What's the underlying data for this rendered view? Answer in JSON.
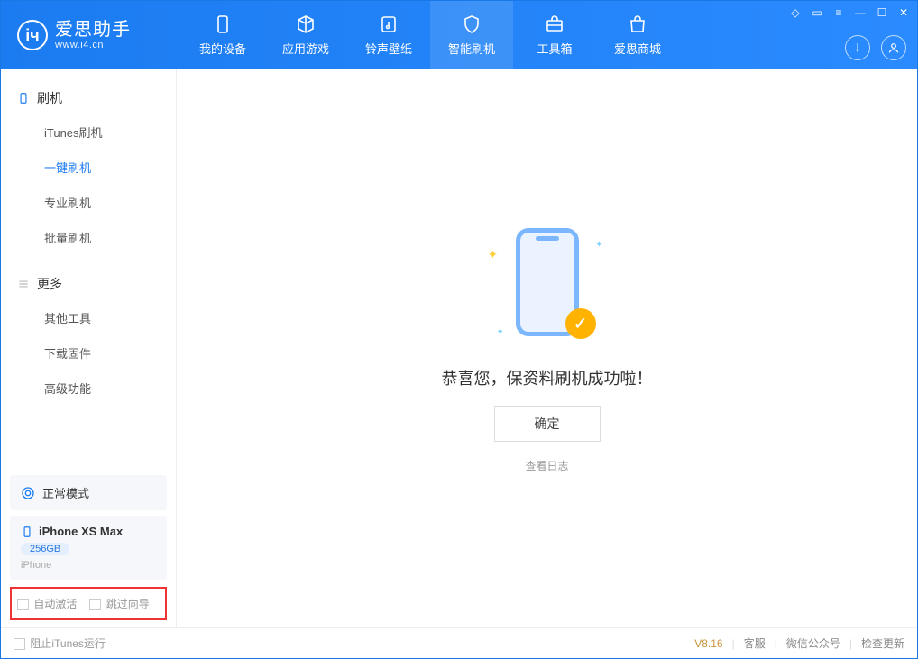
{
  "app": {
    "name": "爱思助手",
    "domain": "www.i4.cn"
  },
  "tabs": {
    "device": "我的设备",
    "apps": "应用游戏",
    "ring": "铃声壁纸",
    "flash": "智能刷机",
    "tools": "工具箱",
    "store": "爱思商城"
  },
  "sidebar": {
    "section_flash": "刷机",
    "items_flash": {
      "itunes": "iTunes刷机",
      "onekey": "一键刷机",
      "pro": "专业刷机",
      "batch": "批量刷机"
    },
    "section_more": "更多",
    "items_more": {
      "other": "其他工具",
      "firmware": "下载固件",
      "advanced": "高级功能"
    }
  },
  "status": {
    "mode": "正常模式"
  },
  "device": {
    "name": "iPhone XS Max",
    "capacity": "256GB",
    "type": "iPhone"
  },
  "options": {
    "auto_activate": "自动激活",
    "skip_guide": "跳过向导"
  },
  "main": {
    "success": "恭喜您，保资料刷机成功啦！",
    "ok": "确定",
    "log": "查看日志"
  },
  "footer": {
    "block_itunes": "阻止iTunes运行",
    "version": "V8.16",
    "cs": "客服",
    "wx": "微信公众号",
    "update": "检查更新"
  }
}
